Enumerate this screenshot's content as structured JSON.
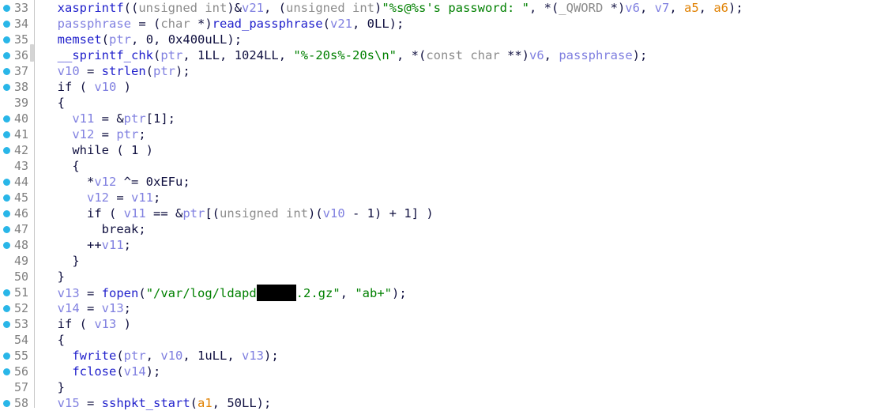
{
  "view": {
    "type": "decompiler-pseudocode",
    "background_color": "#ffffff",
    "gutter_color": "#ffffff",
    "breakpoint_color": "#29b6e8",
    "line_number_color": "#808080",
    "string_color": "#008000",
    "function_color": "#2222cc",
    "variable_color": "#8080e0",
    "argument_color": "#e08000",
    "type_color": "#8c8c8c"
  },
  "lines": [
    {
      "number": "33",
      "breakpoint": true,
      "tokens": [
        {
          "t": "  ",
          "c": "plain"
        },
        {
          "t": "xasprintf",
          "c": "fn"
        },
        {
          "t": "((",
          "c": "punct"
        },
        {
          "t": "unsigned int",
          "c": "type"
        },
        {
          "t": ")&",
          "c": "punct"
        },
        {
          "t": "v21",
          "c": "var"
        },
        {
          "t": ", (",
          "c": "punct"
        },
        {
          "t": "unsigned int",
          "c": "type"
        },
        {
          "t": ")",
          "c": "punct"
        },
        {
          "t": "\"%s@%s's password: \"",
          "c": "str"
        },
        {
          "t": ", *(",
          "c": "punct"
        },
        {
          "t": "_QWORD",
          "c": "type"
        },
        {
          "t": " *)",
          "c": "punct"
        },
        {
          "t": "v6",
          "c": "var"
        },
        {
          "t": ", ",
          "c": "punct"
        },
        {
          "t": "v7",
          "c": "var"
        },
        {
          "t": ", ",
          "c": "punct"
        },
        {
          "t": "a5",
          "c": "arg"
        },
        {
          "t": ", ",
          "c": "punct"
        },
        {
          "t": "a6",
          "c": "arg"
        },
        {
          "t": ");",
          "c": "punct"
        }
      ]
    },
    {
      "number": "34",
      "breakpoint": true,
      "tokens": [
        {
          "t": "  ",
          "c": "plain"
        },
        {
          "t": "passphrase",
          "c": "var"
        },
        {
          "t": " = (",
          "c": "punct"
        },
        {
          "t": "char",
          "c": "type"
        },
        {
          "t": " *)",
          "c": "punct"
        },
        {
          "t": "read_passphrase",
          "c": "fn"
        },
        {
          "t": "(",
          "c": "punct"
        },
        {
          "t": "v21",
          "c": "var"
        },
        {
          "t": ", ",
          "c": "punct"
        },
        {
          "t": "0LL",
          "c": "num"
        },
        {
          "t": ");",
          "c": "punct"
        }
      ]
    },
    {
      "number": "35",
      "breakpoint": true,
      "tokens": [
        {
          "t": "  ",
          "c": "plain"
        },
        {
          "t": "memset",
          "c": "fn"
        },
        {
          "t": "(",
          "c": "punct"
        },
        {
          "t": "ptr",
          "c": "var"
        },
        {
          "t": ", ",
          "c": "punct"
        },
        {
          "t": "0",
          "c": "num"
        },
        {
          "t": ", ",
          "c": "punct"
        },
        {
          "t": "0x400uLL",
          "c": "num"
        },
        {
          "t": ");",
          "c": "punct"
        }
      ]
    },
    {
      "number": "36",
      "breakpoint": true,
      "tokens": [
        {
          "t": "  ",
          "c": "plain"
        },
        {
          "t": "__sprintf_chk",
          "c": "fn"
        },
        {
          "t": "(",
          "c": "punct"
        },
        {
          "t": "ptr",
          "c": "var"
        },
        {
          "t": ", ",
          "c": "punct"
        },
        {
          "t": "1LL",
          "c": "num"
        },
        {
          "t": ", ",
          "c": "punct"
        },
        {
          "t": "1024LL",
          "c": "num"
        },
        {
          "t": ", ",
          "c": "punct"
        },
        {
          "t": "\"%-20s%-20s\\n\"",
          "c": "str"
        },
        {
          "t": ", *(",
          "c": "punct"
        },
        {
          "t": "const char",
          "c": "type"
        },
        {
          "t": " **)",
          "c": "punct"
        },
        {
          "t": "v6",
          "c": "var"
        },
        {
          "t": ", ",
          "c": "punct"
        },
        {
          "t": "passphrase",
          "c": "var"
        },
        {
          "t": ");",
          "c": "punct"
        }
      ]
    },
    {
      "number": "37",
      "breakpoint": true,
      "tokens": [
        {
          "t": "  ",
          "c": "plain"
        },
        {
          "t": "v10",
          "c": "var"
        },
        {
          "t": " = ",
          "c": "punct"
        },
        {
          "t": "strlen",
          "c": "fn"
        },
        {
          "t": "(",
          "c": "punct"
        },
        {
          "t": "ptr",
          "c": "var"
        },
        {
          "t": ");",
          "c": "punct"
        }
      ]
    },
    {
      "number": "38",
      "breakpoint": true,
      "tokens": [
        {
          "t": "  ",
          "c": "plain"
        },
        {
          "t": "if",
          "c": "kw"
        },
        {
          "t": " ( ",
          "c": "punct"
        },
        {
          "t": "v10",
          "c": "var"
        },
        {
          "t": " )",
          "c": "punct"
        }
      ]
    },
    {
      "number": "39",
      "breakpoint": false,
      "tokens": [
        {
          "t": "  {",
          "c": "punct"
        }
      ]
    },
    {
      "number": "40",
      "breakpoint": true,
      "tokens": [
        {
          "t": "    ",
          "c": "plain"
        },
        {
          "t": "v11",
          "c": "var"
        },
        {
          "t": " = &",
          "c": "punct"
        },
        {
          "t": "ptr",
          "c": "var"
        },
        {
          "t": "[",
          "c": "punct"
        },
        {
          "t": "1",
          "c": "num"
        },
        {
          "t": "];",
          "c": "punct"
        }
      ]
    },
    {
      "number": "41",
      "breakpoint": true,
      "tokens": [
        {
          "t": "    ",
          "c": "plain"
        },
        {
          "t": "v12",
          "c": "var"
        },
        {
          "t": " = ",
          "c": "punct"
        },
        {
          "t": "ptr",
          "c": "var"
        },
        {
          "t": ";",
          "c": "punct"
        }
      ]
    },
    {
      "number": "42",
      "breakpoint": true,
      "tokens": [
        {
          "t": "    ",
          "c": "plain"
        },
        {
          "t": "while",
          "c": "kw"
        },
        {
          "t": " ( ",
          "c": "punct"
        },
        {
          "t": "1",
          "c": "num"
        },
        {
          "t": " )",
          "c": "punct"
        }
      ]
    },
    {
      "number": "43",
      "breakpoint": false,
      "tokens": [
        {
          "t": "    {",
          "c": "punct"
        }
      ]
    },
    {
      "number": "44",
      "breakpoint": true,
      "tokens": [
        {
          "t": "      *",
          "c": "punct"
        },
        {
          "t": "v12",
          "c": "var"
        },
        {
          "t": " ^= ",
          "c": "punct"
        },
        {
          "t": "0xEFu",
          "c": "num"
        },
        {
          "t": ";",
          "c": "punct"
        }
      ]
    },
    {
      "number": "45",
      "breakpoint": true,
      "tokens": [
        {
          "t": "      ",
          "c": "plain"
        },
        {
          "t": "v12",
          "c": "var"
        },
        {
          "t": " = ",
          "c": "punct"
        },
        {
          "t": "v11",
          "c": "var"
        },
        {
          "t": ";",
          "c": "punct"
        }
      ]
    },
    {
      "number": "46",
      "breakpoint": true,
      "tokens": [
        {
          "t": "      ",
          "c": "plain"
        },
        {
          "t": "if",
          "c": "kw"
        },
        {
          "t": " ( ",
          "c": "punct"
        },
        {
          "t": "v11",
          "c": "var"
        },
        {
          "t": " == &",
          "c": "punct"
        },
        {
          "t": "ptr",
          "c": "var"
        },
        {
          "t": "[(",
          "c": "punct"
        },
        {
          "t": "unsigned int",
          "c": "type"
        },
        {
          "t": ")(",
          "c": "punct"
        },
        {
          "t": "v10",
          "c": "var"
        },
        {
          "t": " - ",
          "c": "punct"
        },
        {
          "t": "1",
          "c": "num"
        },
        {
          "t": ") + ",
          "c": "punct"
        },
        {
          "t": "1",
          "c": "num"
        },
        {
          "t": "] )",
          "c": "punct"
        }
      ]
    },
    {
      "number": "47",
      "breakpoint": true,
      "tokens": [
        {
          "t": "        ",
          "c": "plain"
        },
        {
          "t": "break",
          "c": "kw"
        },
        {
          "t": ";",
          "c": "punct"
        }
      ]
    },
    {
      "number": "48",
      "breakpoint": true,
      "tokens": [
        {
          "t": "      ++",
          "c": "punct"
        },
        {
          "t": "v11",
          "c": "var"
        },
        {
          "t": ";",
          "c": "punct"
        }
      ]
    },
    {
      "number": "49",
      "breakpoint": false,
      "tokens": [
        {
          "t": "    }",
          "c": "punct"
        }
      ]
    },
    {
      "number": "50",
      "breakpoint": false,
      "tokens": [
        {
          "t": "  }",
          "c": "punct"
        }
      ]
    },
    {
      "number": "51",
      "breakpoint": true,
      "redacted": true,
      "tokens": [
        {
          "t": "  ",
          "c": "plain"
        },
        {
          "t": "v13",
          "c": "var"
        },
        {
          "t": " = ",
          "c": "punct"
        },
        {
          "t": "fopen",
          "c": "fn"
        },
        {
          "t": "(",
          "c": "punct"
        },
        {
          "t": "\"/var/log/ldapd",
          "c": "str"
        },
        {
          "t": "REDACTION",
          "c": "redact"
        },
        {
          "t": ".2.gz\"",
          "c": "str"
        },
        {
          "t": ", ",
          "c": "punct"
        },
        {
          "t": "\"ab+\"",
          "c": "str"
        },
        {
          "t": ");",
          "c": "punct"
        }
      ]
    },
    {
      "number": "52",
      "breakpoint": true,
      "tokens": [
        {
          "t": "  ",
          "c": "plain"
        },
        {
          "t": "v14",
          "c": "var"
        },
        {
          "t": " = ",
          "c": "punct"
        },
        {
          "t": "v13",
          "c": "var"
        },
        {
          "t": ";",
          "c": "punct"
        }
      ]
    },
    {
      "number": "53",
      "breakpoint": true,
      "tokens": [
        {
          "t": "  ",
          "c": "plain"
        },
        {
          "t": "if",
          "c": "kw"
        },
        {
          "t": " ( ",
          "c": "punct"
        },
        {
          "t": "v13",
          "c": "var"
        },
        {
          "t": " )",
          "c": "punct"
        }
      ]
    },
    {
      "number": "54",
      "breakpoint": false,
      "tokens": [
        {
          "t": "  {",
          "c": "punct"
        }
      ]
    },
    {
      "number": "55",
      "breakpoint": true,
      "tokens": [
        {
          "t": "    ",
          "c": "plain"
        },
        {
          "t": "fwrite",
          "c": "fn"
        },
        {
          "t": "(",
          "c": "punct"
        },
        {
          "t": "ptr",
          "c": "var"
        },
        {
          "t": ", ",
          "c": "punct"
        },
        {
          "t": "v10",
          "c": "var"
        },
        {
          "t": ", ",
          "c": "punct"
        },
        {
          "t": "1uLL",
          "c": "num"
        },
        {
          "t": ", ",
          "c": "punct"
        },
        {
          "t": "v13",
          "c": "var"
        },
        {
          "t": ");",
          "c": "punct"
        }
      ]
    },
    {
      "number": "56",
      "breakpoint": true,
      "tokens": [
        {
          "t": "    ",
          "c": "plain"
        },
        {
          "t": "fclose",
          "c": "fn"
        },
        {
          "t": "(",
          "c": "punct"
        },
        {
          "t": "v14",
          "c": "var"
        },
        {
          "t": ");",
          "c": "punct"
        }
      ]
    },
    {
      "number": "57",
      "breakpoint": false,
      "tokens": [
        {
          "t": "  }",
          "c": "punct"
        }
      ]
    },
    {
      "number": "58",
      "breakpoint": true,
      "tokens": [
        {
          "t": "  ",
          "c": "plain"
        },
        {
          "t": "v15",
          "c": "var"
        },
        {
          "t": " = ",
          "c": "punct"
        },
        {
          "t": "sshpkt_start",
          "c": "fn"
        },
        {
          "t": "(",
          "c": "punct"
        },
        {
          "t": "a1",
          "c": "arg"
        },
        {
          "t": ", ",
          "c": "punct"
        },
        {
          "t": "50LL",
          "c": "num"
        },
        {
          "t": ");",
          "c": "punct"
        }
      ]
    }
  ]
}
